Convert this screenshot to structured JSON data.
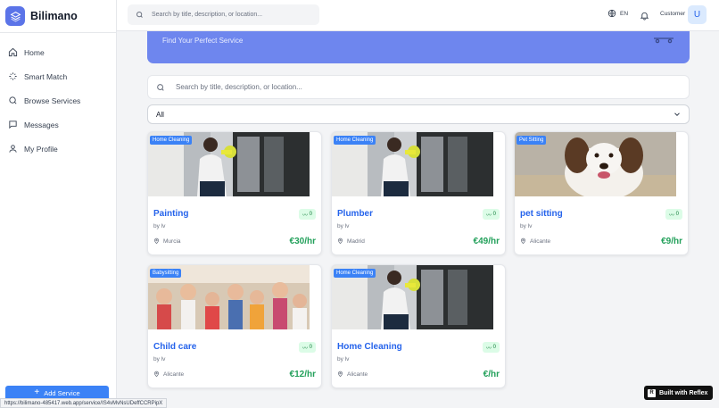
{
  "app": {
    "name": "Bilimano",
    "logo_icon": "layers-icon",
    "brand_color": "#5b74e8"
  },
  "sidebar": {
    "items": [
      {
        "label": "Home",
        "icon": "home-icon"
      },
      {
        "label": "Smart Match",
        "icon": "sparkles-icon"
      },
      {
        "label": "Browse Services",
        "icon": "search-icon"
      },
      {
        "label": "Messages",
        "icon": "message-icon"
      },
      {
        "label": "My Profile",
        "icon": "user-icon"
      }
    ],
    "add_service_label": "Add Service"
  },
  "topbar": {
    "search_placeholder": "Search by title, description, or location...",
    "language": "EN",
    "role": "Customer",
    "avatar_initial": "U"
  },
  "banner": {
    "subtitle": "Find Your Perfect Service"
  },
  "main": {
    "search_placeholder": "Search by title, description, or location...",
    "filter_value": "All"
  },
  "services": [
    {
      "category": "Home Cleaning",
      "title": "Painting",
      "by": "by lv",
      "location": "Murcia",
      "price": "€30/hr",
      "rating": "0",
      "image": "person-cleaning-window"
    },
    {
      "category": "Home Cleaning",
      "title": "Plumber",
      "by": "by lv",
      "location": "Madrid",
      "price": "€49/hr",
      "rating": "0",
      "image": "person-cleaning-window"
    },
    {
      "category": "Pet Sitting",
      "title": "pet sitting",
      "by": "by lv",
      "location": "Alicante",
      "price": "€9/hr",
      "rating": "0",
      "image": "dog-portrait"
    },
    {
      "category": "Babysitting",
      "title": "Child care",
      "by": "by lv",
      "location": "Alicante",
      "price": "€12/hr",
      "rating": "0",
      "image": "children-group"
    },
    {
      "category": "Home Cleaning",
      "title": "Home Cleaning",
      "by": "by lv",
      "location": "Alicante",
      "price": "€/hr",
      "rating": "0",
      "image": "person-cleaning-window"
    }
  ],
  "status_url": "https://bilimano-485417.web.app/service/IS4vMvNsUDeffCCRPipX",
  "reflex_badge": "Built with Reflex"
}
